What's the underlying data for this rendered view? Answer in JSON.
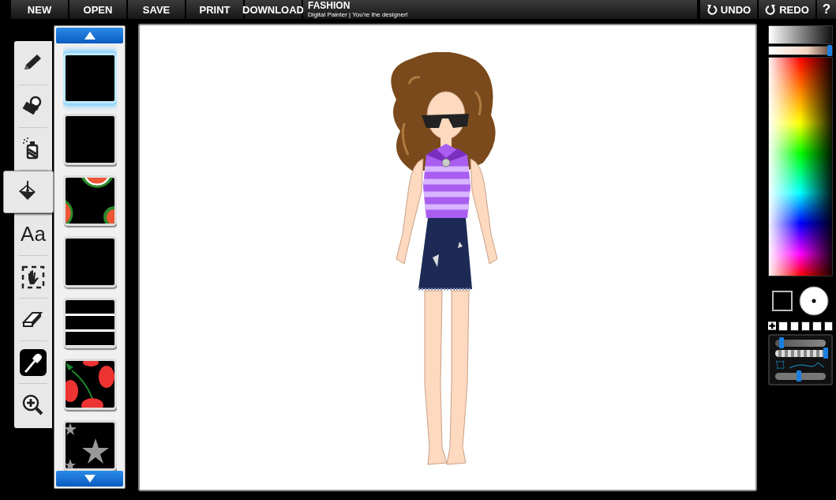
{
  "menu": [
    {
      "label": "NEW"
    },
    {
      "label": "OPEN"
    },
    {
      "label": "SAVE"
    },
    {
      "label": "PRINT"
    },
    {
      "label": "DOWNLOAD"
    }
  ],
  "app": {
    "title": "FASHION",
    "subtitle": "Digital Painter | You're the designer!"
  },
  "history": [
    {
      "kind": "undo",
      "label": "UNDO"
    },
    {
      "kind": "redo",
      "label": "REDO"
    },
    {
      "kind": "help",
      "label": "?"
    }
  ],
  "tools": [
    {
      "kind": "pencil",
      "selected": false
    },
    {
      "kind": "stamp",
      "selected": false
    },
    {
      "kind": "spray",
      "selected": false
    },
    {
      "kind": "bucket",
      "selected": true
    },
    {
      "kind": "text",
      "label": "Aa",
      "selected": false
    },
    {
      "kind": "move",
      "selected": false
    },
    {
      "kind": "eraser",
      "selected": false
    },
    {
      "kind": "dropper",
      "selected": false
    },
    {
      "kind": "zoom",
      "selected": false
    }
  ],
  "patterns": [
    {
      "kind": "solid",
      "selected": true
    },
    {
      "kind": "solid",
      "selected": false
    },
    {
      "kind": "watermelon",
      "selected": false
    },
    {
      "kind": "solid",
      "selected": false
    },
    {
      "kind": "stripes",
      "selected": false
    },
    {
      "kind": "strawberry",
      "selected": false
    },
    {
      "kind": "stars",
      "selected": false
    }
  ],
  "color_panel": {
    "tint": {
      "level": 1.0
    },
    "brush_size": {
      "level": 0.12
    },
    "opacity": {
      "level": 1.0
    },
    "smoothing": {
      "level": 0.47
    }
  }
}
